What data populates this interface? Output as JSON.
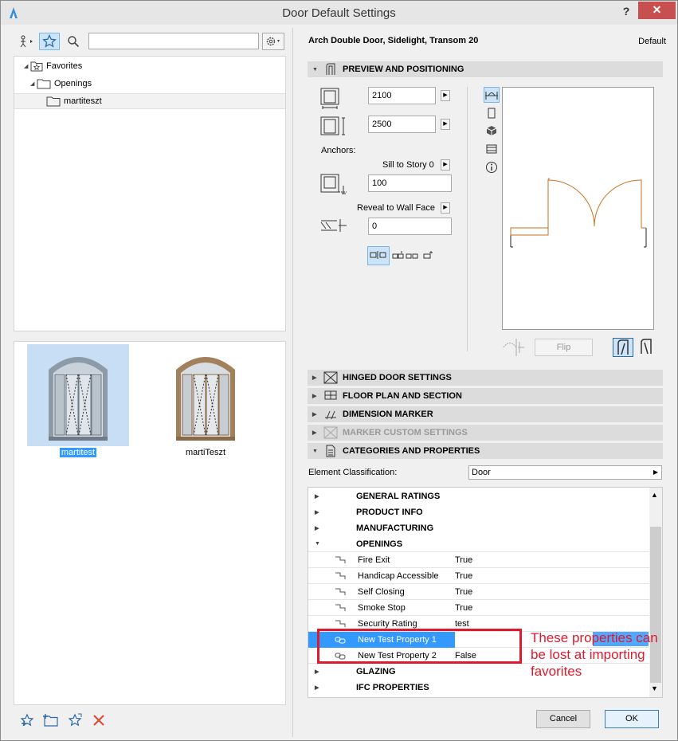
{
  "window": {
    "title": "Door Default Settings",
    "help": "?",
    "close": "✕"
  },
  "left": {
    "search": {
      "value": "",
      "placeholder": ""
    },
    "tree": [
      {
        "label": "Favorites"
      },
      {
        "label": "Openings"
      },
      {
        "label": "martiteszt"
      }
    ],
    "thumbs": [
      {
        "label": "martitest"
      },
      {
        "label": "martiTeszt"
      }
    ]
  },
  "right": {
    "door_name": "Arch Double Door, Sidelight, Transom 20",
    "default_label": "Default",
    "sections": {
      "preview": "PREVIEW AND POSITIONING",
      "hinged": "HINGED DOOR SETTINGS",
      "floor": "FLOOR PLAN AND SECTION",
      "dimension": "DIMENSION MARKER",
      "marker": "MARKER CUSTOM SETTINGS",
      "categories": "CATEGORIES AND PROPERTIES"
    },
    "positioning": {
      "width": "2100",
      "height": "2500",
      "anchors_label": "Anchors:",
      "sill_label": "Sill to Story 0",
      "sill_value": "100",
      "reveal_label": "Reveal to Wall Face",
      "reveal_value": "0",
      "flip_label": "Flip"
    },
    "classification": {
      "label": "Element Classification:",
      "value": "Door"
    },
    "groups_top": [
      "GENERAL RATINGS",
      "PRODUCT INFO",
      "MANUFACTURING",
      "OPENINGS"
    ],
    "properties": [
      {
        "name": "Fire Exit",
        "value": "True"
      },
      {
        "name": "Handicap Accessible",
        "value": "True"
      },
      {
        "name": "Self Closing",
        "value": "True"
      },
      {
        "name": "Smoke Stop",
        "value": "True"
      },
      {
        "name": "Security Rating",
        "value": "test"
      },
      {
        "name": "New Test Property 1",
        "value": ""
      },
      {
        "name": "New Test Property 2",
        "value": "False"
      }
    ],
    "groups_bottom": [
      "GLAZING",
      "IFC PROPERTIES"
    ],
    "annotation": "These properties can be lost at importing favorites",
    "cancel": "Cancel",
    "ok": "OK"
  },
  "colors": {
    "accent": "#3399ff",
    "annotation": "#e01a2c",
    "door_line": "#c8721e"
  }
}
